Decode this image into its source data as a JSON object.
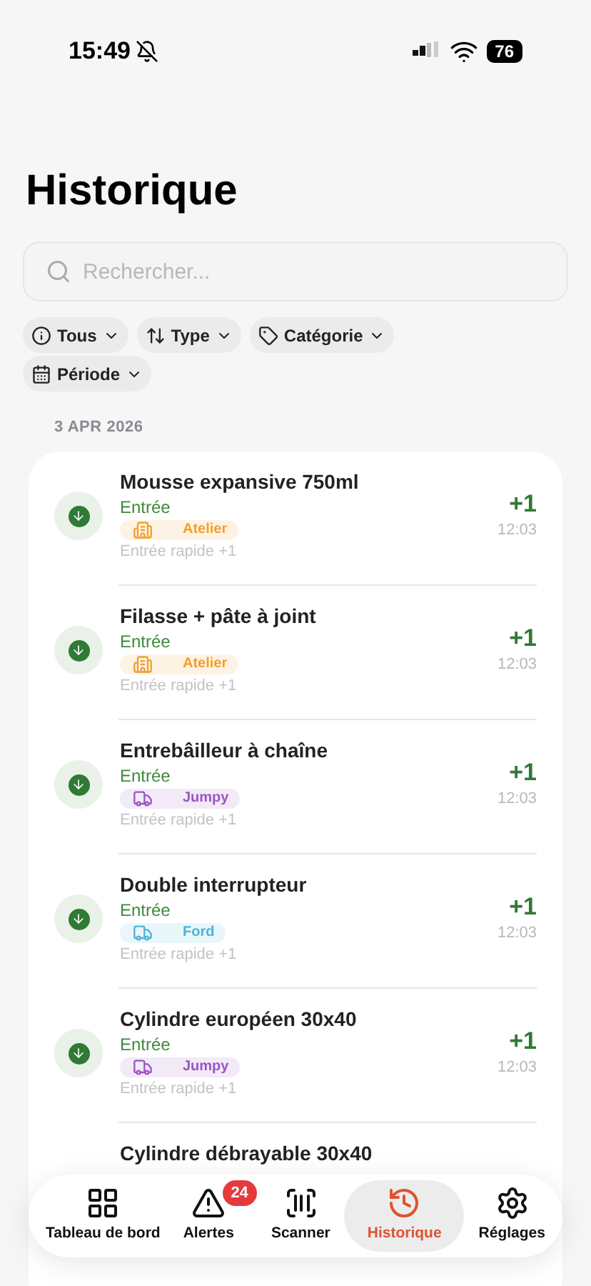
{
  "status_bar": {
    "time": "15:49",
    "battery": "76"
  },
  "title": "Historique",
  "search": {
    "placeholder": "Rechercher..."
  },
  "filters": [
    {
      "label": "Tous",
      "kind": "info"
    },
    {
      "label": "Type",
      "kind": "type"
    },
    {
      "label": "Catégorie",
      "kind": "tag"
    },
    {
      "label": "Période",
      "kind": "calendar"
    }
  ],
  "date": "3 APR 2026",
  "entries": [
    {
      "name": "Mousse expansive 750ml",
      "type": "Entrée",
      "tag": {
        "label": "Atelier",
        "kind": "building",
        "color": "#f0a02c"
      },
      "note": "Entrée rapide +1",
      "quantity": "+1",
      "time": "12:03"
    },
    {
      "name": "Filasse + pâte à joint",
      "type": "Entrée",
      "tag": {
        "label": "Atelier",
        "kind": "building",
        "color": "#f0a02c"
      },
      "note": "Entrée rapide +1",
      "quantity": "+1",
      "time": "12:03"
    },
    {
      "name": "Entrebâilleur à chaîne",
      "type": "Entrée",
      "tag": {
        "label": "Jumpy",
        "kind": "truck",
        "color": "#9b55c4"
      },
      "note": "Entrée rapide +1",
      "quantity": "+1",
      "time": "12:03"
    },
    {
      "name": "Double interrupteur",
      "type": "Entrée",
      "tag": {
        "label": "Ford",
        "kind": "truck",
        "color": "#4cb4d6"
      },
      "note": "Entrée rapide +1",
      "quantity": "+1",
      "time": "12:03"
    },
    {
      "name": "Cylindre européen 30x40",
      "type": "Entrée",
      "tag": {
        "label": "Jumpy",
        "kind": "truck",
        "color": "#9b55c4"
      },
      "note": "Entrée rapide +1",
      "quantity": "+1",
      "time": "12:03"
    },
    {
      "name": "Cylindre débrayable 30x40"
    }
  ],
  "tab_bar": [
    {
      "label": "Tableau de bord",
      "kind": "grid",
      "selected": false
    },
    {
      "label": "Alertes",
      "kind": "alert",
      "badge": "24",
      "selected": false
    },
    {
      "label": "Scanner",
      "kind": "scan",
      "selected": false
    },
    {
      "label": "Historique",
      "kind": "history",
      "selected": true
    },
    {
      "label": "Réglages",
      "kind": "gear",
      "selected": false
    }
  ]
}
